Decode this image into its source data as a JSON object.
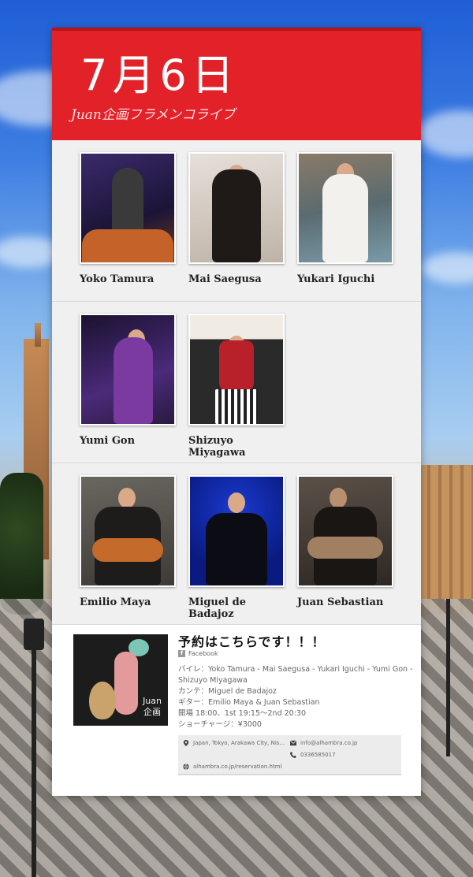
{
  "event": {
    "date": "7月6日",
    "subtitle": "Juan企画フラメンコライブ"
  },
  "performers": {
    "row1": [
      {
        "name": "Yoko Tamura"
      },
      {
        "name": "Mai Saegusa"
      },
      {
        "name": "Yukari Iguchi"
      }
    ],
    "row2": [
      {
        "name": "Yumi Gon"
      },
      {
        "name": "Shizuyo Miyagawa"
      }
    ],
    "row3": [
      {
        "name": "Emilio Maya"
      },
      {
        "name": "Miguel de Badajoz"
      },
      {
        "name": "Juan Sebastian"
      }
    ]
  },
  "reservation": {
    "logo_line1": "Juan",
    "logo_line2": "企画",
    "title": "予約はこちらです！！！",
    "source": "Facebook",
    "lines": [
      "バイレ：Yoko Tamura - Mai Saegusa - Yukari Iguchi - Yumi Gon -",
      "Shizuyo Miyagawa",
      "カンテ：Miguel de Badajoz",
      "ギター：Emilio Maya & Juan Sebastian",
      "開場 18:00、1st 19:15〜2nd 20:30",
      "ショーチャージ：¥3000"
    ],
    "address": "Japan, Tokyo, Arakawa City, Nis...",
    "email": "info@alhambra.co.jp",
    "phone": "0336585017",
    "website": "alhambra.co.jp/reservation.html"
  },
  "colors": {
    "header_red": "#e32129"
  }
}
